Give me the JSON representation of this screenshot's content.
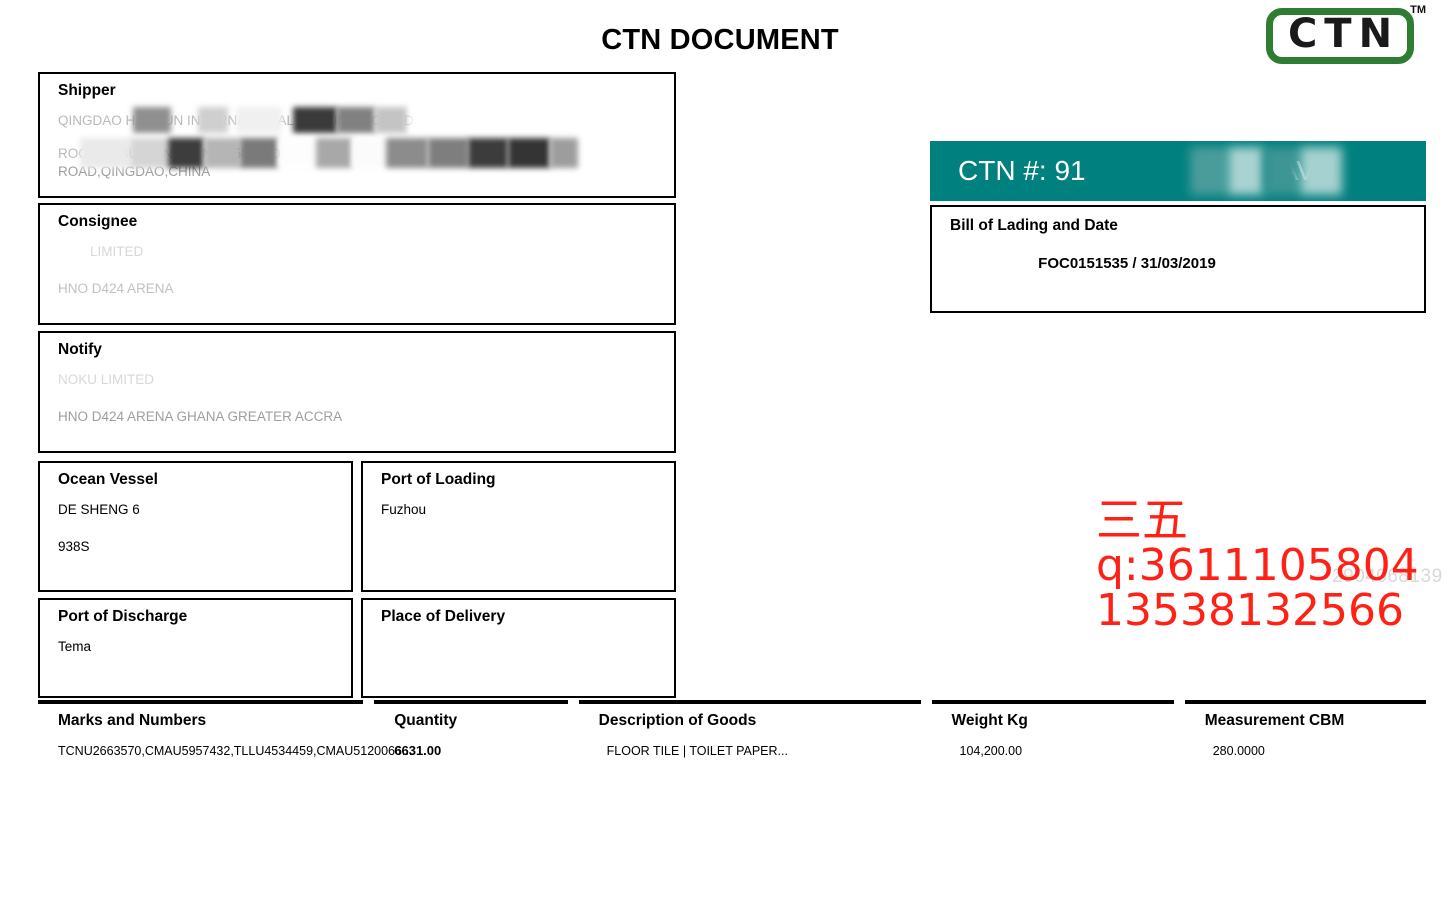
{
  "document": {
    "title": "CTN DOCUMENT"
  },
  "logo": {
    "text": "CTN",
    "trademark": "TM",
    "frame_color": "#2e7d32",
    "letter_color": "#1a1a1a"
  },
  "shipper": {
    "label": "Shipper",
    "line1": "QINGDAO HANRUN INTERNATIONAL TRADING CO.,LTD",
    "line2": "ROOM A, BUILDING 4, NO.150 ZHONG",
    "line3": "ROAD,QINGDAO,CHINA"
  },
  "consignee": {
    "label": "Consignee",
    "line1": "LIMITED",
    "line2": "HNO D424 ARENA"
  },
  "notify": {
    "label": "Notify",
    "line1": "NOKU LIMITED",
    "line2": "HNO D424 ARENA GHANA GREATER ACCRA"
  },
  "ocean_vessel": {
    "label": "Ocean Vessel",
    "name": "DE SHENG 6",
    "voyage": "938S"
  },
  "port_of_loading": {
    "label": "Port of Loading",
    "value": "Fuzhou"
  },
  "port_of_discharge": {
    "label": "Port of Discharge",
    "value": "Tema"
  },
  "place_of_delivery": {
    "label": "Place of Delivery",
    "value": ""
  },
  "ctn_banner": {
    "text": "CTN #: 91",
    "suffix": "AVU",
    "background_color": "#00807f",
    "text_color": "#ffffff"
  },
  "bill_of_lading": {
    "label": "Bill of Lading and Date",
    "value": "FOC0151535 / 31/03/2019"
  },
  "goods_table": {
    "columns": [
      {
        "header": "Marks and Numbers",
        "value": "TCNU2663570,CMAU5957432,TLLU4534459,CMAU5120066..."
      },
      {
        "header": "Quantity",
        "value": "6631.00"
      },
      {
        "header": "Description of Goods",
        "value": "FLOOR TILE | TOILET PAPER..."
      },
      {
        "header": "Weight Kg",
        "value": "104,200.00"
      },
      {
        "header": "Measurement CBM",
        "value": "280.0000"
      }
    ]
  },
  "contact_overlay": {
    "chinese": "三五",
    "qq": "q:3611105804",
    "phone": "13538132566",
    "color": "#ff2116"
  },
  "ghost_watermark": {
    "text": "2904068139"
  }
}
